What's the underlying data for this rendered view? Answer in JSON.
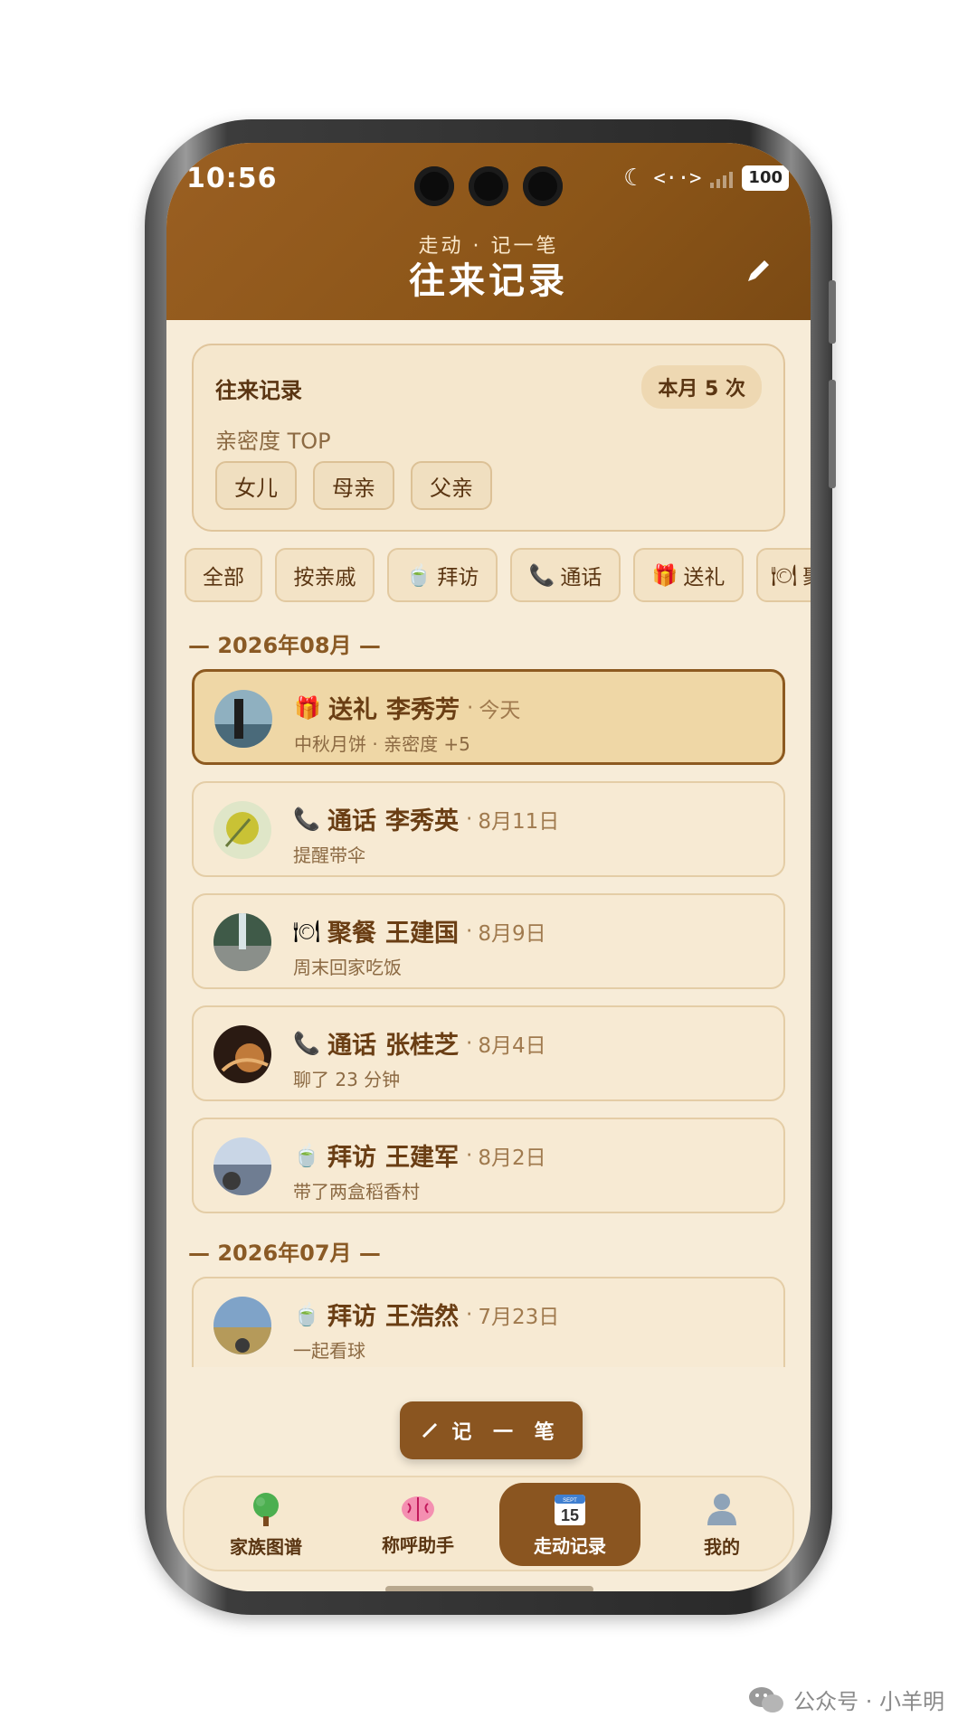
{
  "status": {
    "time": "10:56",
    "battery": "100"
  },
  "header": {
    "subtitle": "走动 · 记一笔",
    "title": "往来记录"
  },
  "summary": {
    "title": "往来记录",
    "badge": "本月 5 次",
    "subtitle": "亲密度 TOP",
    "top": [
      "女儿",
      "母亲",
      "父亲"
    ]
  },
  "filters": [
    "全部",
    "按亲戚",
    "拜访",
    "通话",
    "送礼",
    "聚"
  ],
  "groups": [
    {
      "month": "— 2026年08月 —",
      "records": [
        {
          "type": "送礼",
          "name": "李秀芳",
          "date": "今天",
          "note": "中秋月饼 · 亲密度 +5",
          "icon": "gift-icon"
        },
        {
          "type": "通话",
          "name": "李秀英",
          "date": "8月11日",
          "note": "提醒带伞",
          "icon": "phone-icon"
        },
        {
          "type": "聚餐",
          "name": "王建国",
          "date": "8月9日",
          "note": "周末回家吃饭",
          "icon": "plate-icon"
        },
        {
          "type": "通话",
          "name": "张桂芝",
          "date": "8月4日",
          "note": "聊了 23 分钟",
          "icon": "phone-icon"
        },
        {
          "type": "拜访",
          "name": "王建军",
          "date": "8月2日",
          "note": "带了两盒稻香村",
          "icon": "tea-icon"
        }
      ]
    },
    {
      "month": "— 2026年07月 —",
      "records": [
        {
          "type": "拜访",
          "name": "王浩然",
          "date": "7月23日",
          "note": "一起看球",
          "icon": "tea-icon"
        }
      ]
    }
  ],
  "fab": {
    "label": "记 一 笔"
  },
  "tabs": [
    {
      "label": "家族图谱",
      "icon": "tree-icon"
    },
    {
      "label": "称呼助手",
      "icon": "brain-icon"
    },
    {
      "label": "走动记录",
      "icon": "calendar-icon",
      "calendar_month": "SEPT",
      "calendar_day": "15"
    },
    {
      "label": "我的",
      "icon": "person-icon"
    }
  ],
  "watermark": "公众号 · 小羊明",
  "colors": {
    "brand": "#8a5520",
    "background": "#f7ecd8",
    "accent_text": "#6a3e14"
  }
}
